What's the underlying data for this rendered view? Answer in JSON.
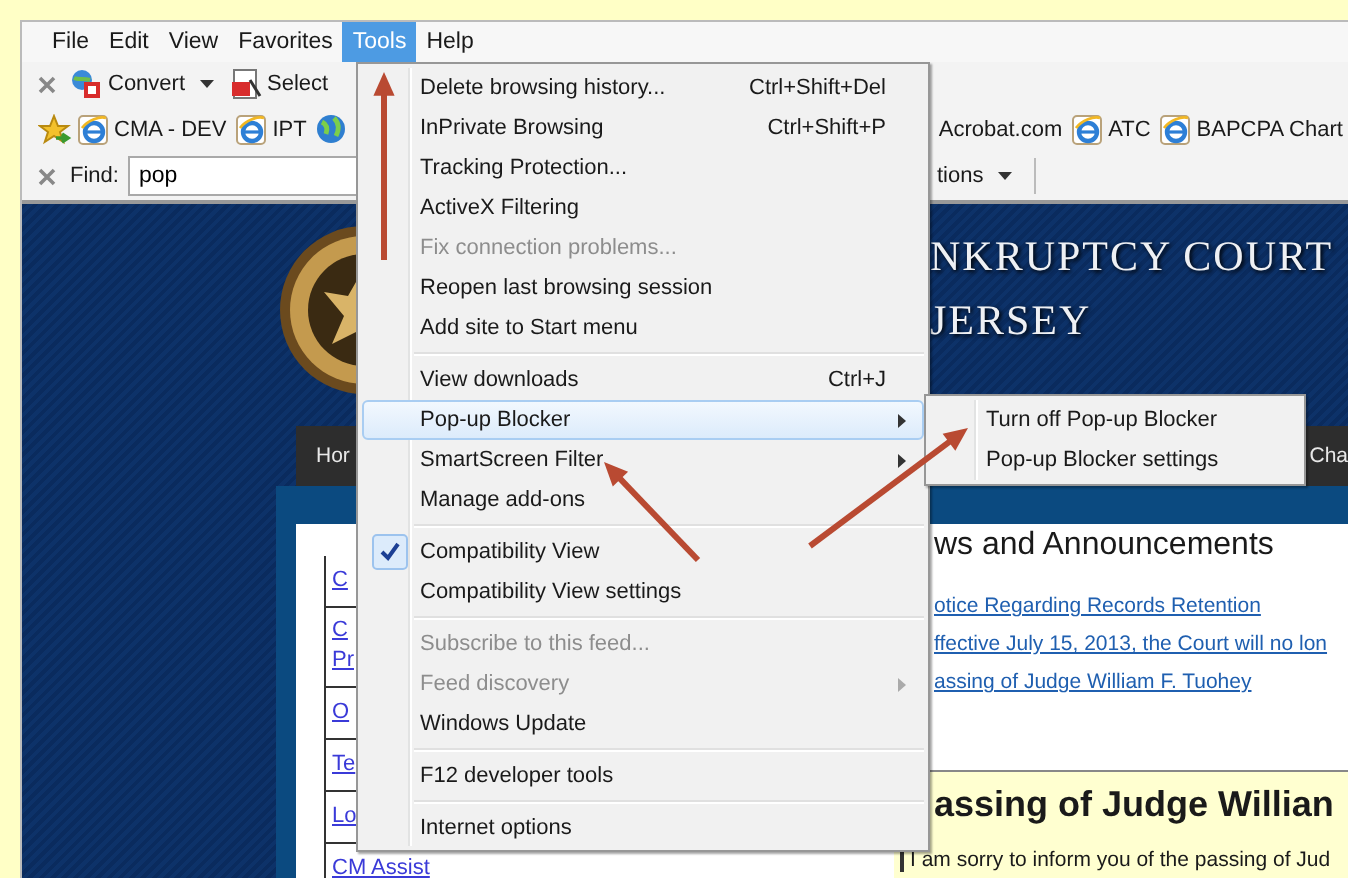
{
  "menubar": [
    {
      "label": "File",
      "selected": false
    },
    {
      "label": "Edit",
      "selected": false
    },
    {
      "label": "View",
      "selected": false
    },
    {
      "label": "Favorites",
      "selected": false
    },
    {
      "label": "Tools",
      "selected": true
    },
    {
      "label": "Help",
      "selected": false
    }
  ],
  "command_bar": {
    "items": [
      {
        "label": "Convert",
        "dropdown": true
      },
      {
        "label": "Select",
        "dropdown": false
      }
    ]
  },
  "favorites_bar": {
    "items": [
      {
        "label": "CMA - DEV",
        "kind": "page"
      },
      {
        "label": "IPT",
        "kind": "page"
      },
      {
        "label": "Acrobat.com",
        "kind": "plain"
      },
      {
        "label": "ATC",
        "kind": "page"
      },
      {
        "label": "BAPCPA Chart",
        "kind": "page"
      }
    ]
  },
  "find_bar": {
    "label": "Find:",
    "value": "pop",
    "options_label": "tions"
  },
  "page": {
    "title_lines": [
      "NKRUPTCY COURT",
      "JERSEY"
    ],
    "nav": [
      "Hor",
      "Cha"
    ],
    "side_links": [
      "C",
      "C\nPr",
      "O",
      "Te",
      "Lo",
      "CM Assist"
    ],
    "news_heading": "ws and Announcements",
    "news_links": [
      "otice Regarding Records Retention",
      "ffective July 15, 2013, the Court will no lon",
      "assing of Judge William F. Tuohey"
    ],
    "feature_heading": "assing of Judge Willian",
    "feature_text": "I am sorry to inform you of the passing of Jud"
  },
  "tools_menu": {
    "groups": [
      {
        "items": [
          {
            "label": "Delete browsing history...",
            "shortcut": "Ctrl+Shift+Del",
            "disabled": false,
            "checked": false,
            "selected": false,
            "submenu": false
          },
          {
            "label": "InPrivate Browsing",
            "shortcut": "Ctrl+Shift+P",
            "disabled": false,
            "checked": false,
            "selected": false,
            "submenu": false
          },
          {
            "label": "Tracking Protection...",
            "disabled": false,
            "checked": false,
            "selected": false,
            "submenu": false
          },
          {
            "label": "ActiveX Filtering",
            "disabled": false,
            "checked": false,
            "selected": false,
            "submenu": false
          },
          {
            "label": "Fix connection problems...",
            "disabled": true,
            "checked": false,
            "selected": false,
            "submenu": false
          },
          {
            "label": "Reopen last browsing session",
            "disabled": false,
            "checked": false,
            "selected": false,
            "submenu": false
          },
          {
            "label": "Add site to Start menu",
            "disabled": false,
            "checked": false,
            "selected": false,
            "submenu": false
          }
        ]
      },
      {
        "items": [
          {
            "label": "View downloads",
            "shortcut": "Ctrl+J",
            "disabled": false,
            "checked": false,
            "selected": false,
            "submenu": false
          },
          {
            "label": "Pop-up Blocker",
            "disabled": false,
            "checked": false,
            "selected": true,
            "submenu": true
          },
          {
            "label": "SmartScreen Filter",
            "disabled": false,
            "checked": false,
            "selected": false,
            "submenu": true
          },
          {
            "label": "Manage add-ons",
            "disabled": false,
            "checked": false,
            "selected": false,
            "submenu": false
          }
        ]
      },
      {
        "items": [
          {
            "label": "Compatibility View",
            "disabled": false,
            "checked": true,
            "selected": false,
            "submenu": false
          },
          {
            "label": "Compatibility View settings",
            "disabled": false,
            "checked": false,
            "selected": false,
            "submenu": false
          }
        ]
      },
      {
        "items": [
          {
            "label": "Subscribe to this feed...",
            "disabled": true,
            "checked": false,
            "selected": false,
            "submenu": false
          },
          {
            "label": "Feed discovery",
            "disabled": true,
            "checked": false,
            "selected": false,
            "submenu": true
          },
          {
            "label": "Windows Update",
            "disabled": false,
            "checked": false,
            "selected": false,
            "submenu": false
          }
        ]
      },
      {
        "items": [
          {
            "label": "F12 developer tools",
            "disabled": false,
            "checked": false,
            "selected": false,
            "submenu": false
          }
        ]
      },
      {
        "items": [
          {
            "label": "Internet options",
            "disabled": false,
            "checked": false,
            "selected": false,
            "submenu": false
          }
        ]
      }
    ]
  },
  "popup_submenu": {
    "items": [
      {
        "label": "Turn off Pop-up Blocker",
        "selected": false
      },
      {
        "label": "Pop-up Blocker settings",
        "selected": false
      }
    ]
  }
}
